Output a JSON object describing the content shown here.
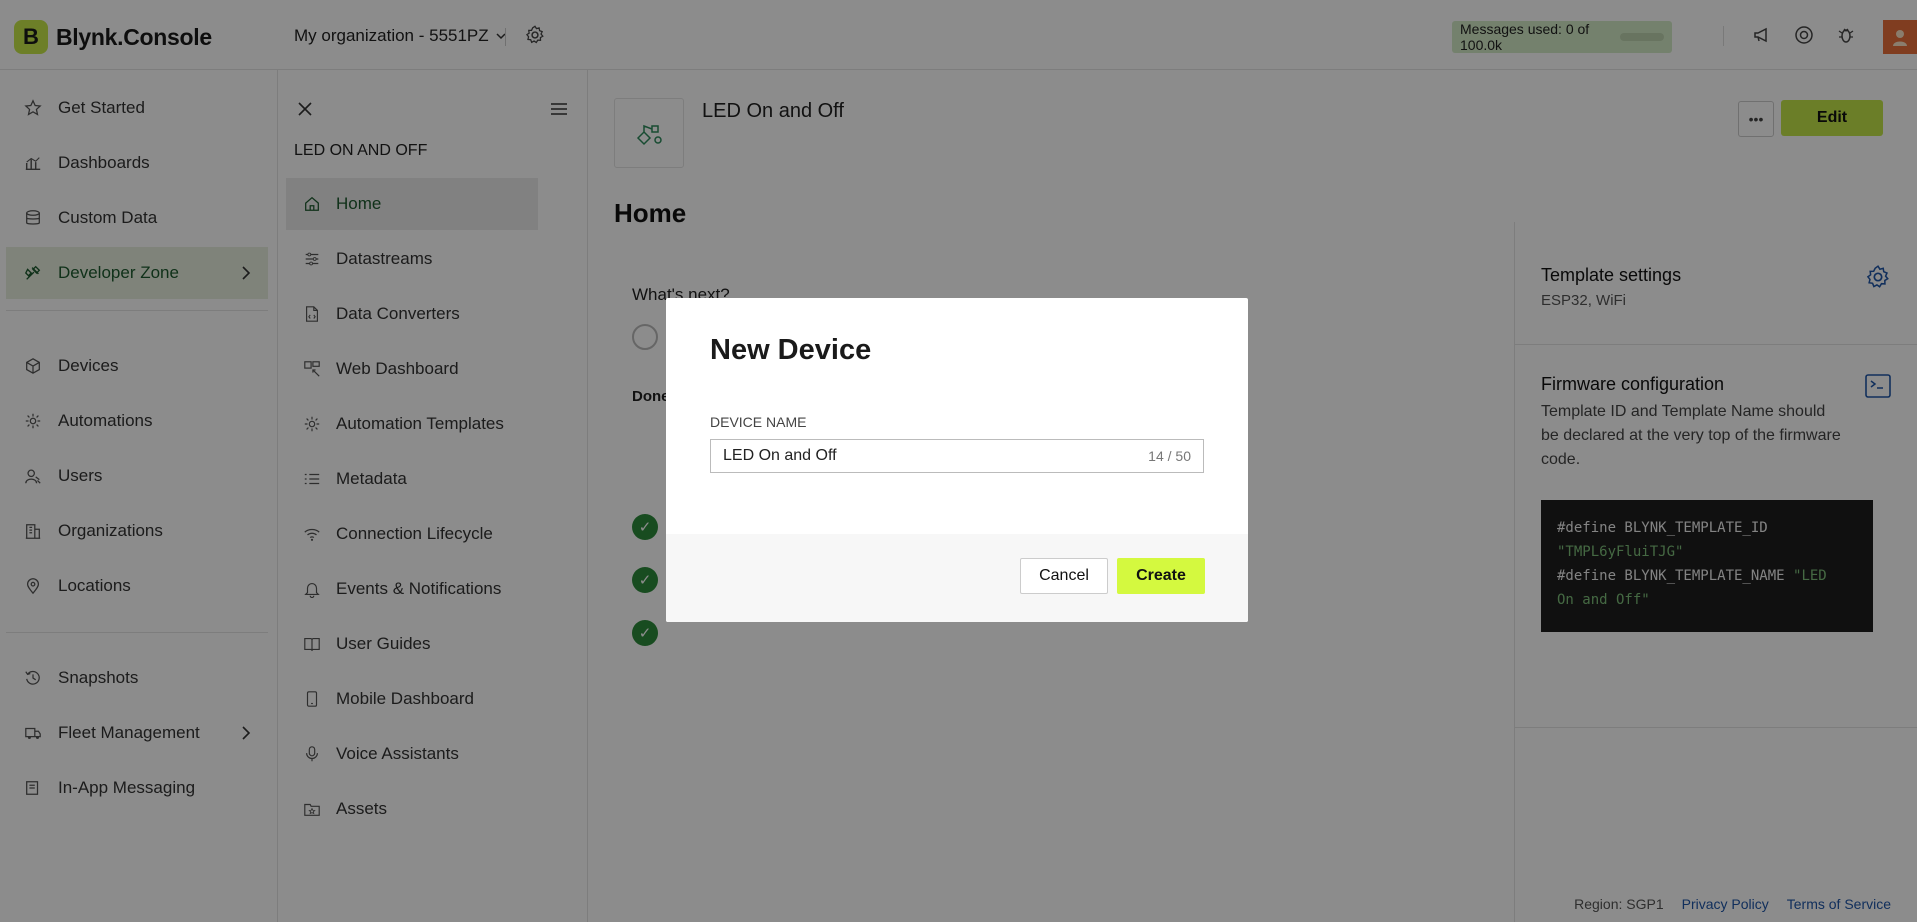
{
  "brand": {
    "logo_letter": "B",
    "name": "Blynk.Console"
  },
  "topbar": {
    "org_name": "My organization - 5551PZ",
    "messages_used": "Messages used: 0 of 100.0k",
    "icons": [
      "megaphone-icon",
      "help-ring-icon",
      "bug-icon"
    ]
  },
  "leftnav": {
    "items": [
      {
        "label": "Get Started",
        "icon": "star-icon"
      },
      {
        "label": "Dashboards",
        "icon": "chart-icon"
      },
      {
        "label": "Custom Data",
        "icon": "database-icon"
      },
      {
        "label": "Developer Zone",
        "icon": "tools-icon",
        "active": true
      },
      {
        "label": "Devices",
        "icon": "cube-icon"
      },
      {
        "label": "Automations",
        "icon": "automation-icon"
      },
      {
        "label": "Users",
        "icon": "users-icon"
      },
      {
        "label": "Organizations",
        "icon": "building-icon"
      },
      {
        "label": "Locations",
        "icon": "location-pin-icon"
      },
      {
        "label": "Snapshots",
        "icon": "snapshot-icon"
      },
      {
        "label": "Fleet Management",
        "icon": "truck-icon"
      },
      {
        "label": "In-App Messaging",
        "icon": "message-icon"
      }
    ]
  },
  "subnav": {
    "title": "LED ON AND OFF",
    "items": [
      {
        "label": "Home",
        "active": true
      },
      {
        "label": "Datastreams"
      },
      {
        "label": "Data Converters"
      },
      {
        "label": "Web Dashboard"
      },
      {
        "label": "Automation Templates"
      },
      {
        "label": "Metadata"
      },
      {
        "label": "Connection Lifecycle"
      },
      {
        "label": "Events & Notifications"
      },
      {
        "label": "User Guides"
      },
      {
        "label": "Mobile Dashboard"
      },
      {
        "label": "Voice Assistants"
      },
      {
        "label": "Assets"
      }
    ]
  },
  "main": {
    "template_name": "LED On and Off",
    "more_label": "•••",
    "edit_label": "Edit",
    "page_heading": "Home",
    "whats_next": "What's next?",
    "done_label": "Done",
    "template_settings": {
      "title": "Template settings",
      "subtitle": "ESP32, WiFi"
    },
    "firmware": {
      "title": "Firmware configuration",
      "description": "Template ID and Template Name should be declared at the very top of the firmware code.",
      "code_line1": "#define BLYNK_TEMPLATE_ID",
      "code_line2": "\"TMPL6yFluiTJG\"",
      "code_line3_kw": "#define BLYNK_TEMPLATE_NAME ",
      "code_line3_str": "\"LED",
      "code_line4": "On and Off\""
    }
  },
  "footer": {
    "region": "Region: SGP1",
    "privacy": "Privacy Policy",
    "terms": "Terms of Service"
  },
  "modal": {
    "title": "New Device",
    "field_label": "DEVICE NAME",
    "field_value": "LED On and Off",
    "field_counter": "14 / 50",
    "cancel_label": "Cancel",
    "create_label": "Create"
  },
  "colors": {
    "accent": "#c3e64a",
    "create": "#d4f93f",
    "active_text": "#1d5a2e",
    "link": "#1f56a8"
  }
}
